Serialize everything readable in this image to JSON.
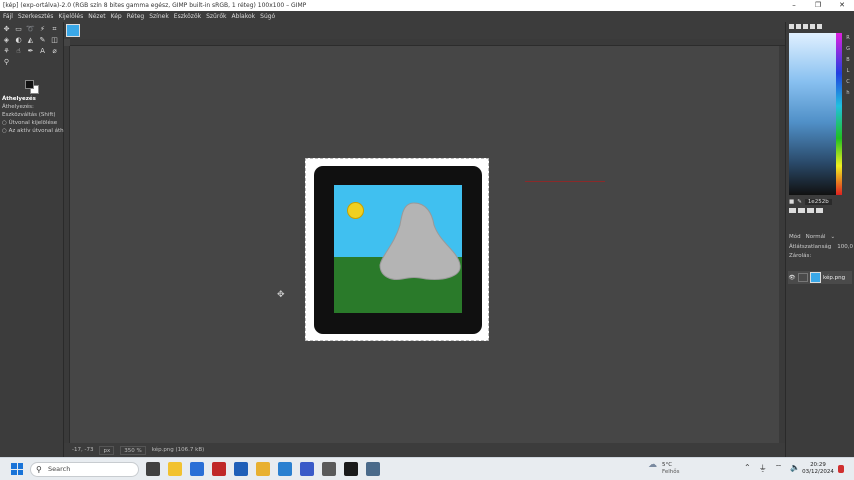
{
  "window": {
    "title": "[kép] (exp-ortálva)-2.0 (RGB szín 8 bites gamma egész, GIMP built-in sRGB, 1 réteg) 100x100 – GIMP",
    "controls": [
      "–",
      "❐",
      "✕"
    ]
  },
  "menu": [
    "Fájl",
    "Szerkesztés",
    "Kijelölés",
    "Nézet",
    "Kép",
    "Réteg",
    "Színek",
    "Eszközök",
    "Szűrők",
    "Ablakok",
    "Súgó"
  ],
  "tool_options": {
    "title": "Áthelyezés",
    "move_label": "Áthelyezés:",
    "toggle_label": "Eszközváltás  (Shift)",
    "radio1": "Útvonal kijelölése",
    "radio2": "Az aktív útvonal áth"
  },
  "status_bar": {
    "coords": "-17, -73",
    "unit": "px",
    "zoom": "350 %",
    "file": "kép.png (106.7 kB)"
  },
  "right_panel": {
    "color_letters": [
      "R",
      "G",
      "B",
      "L",
      "C",
      "h"
    ],
    "hex": "1e252b",
    "mode_label": "Mód",
    "mode_value": "Normál",
    "opacity_label": "Átlátszatlanság",
    "opacity_value": "100,0",
    "lock_label": "Zárolás:",
    "layer_name": "kép.png"
  },
  "image": {
    "sky_color": "#40c0f0",
    "ground_color": "#2a7a2a",
    "sun_color": "#f0d020",
    "mountain_color": "#b4b4b4"
  },
  "taskbar": {
    "search_placeholder": "Search",
    "weather_temp": "5°C",
    "weather_desc": "Felhős",
    "time": "20:29",
    "date": "03/12/2024"
  }
}
